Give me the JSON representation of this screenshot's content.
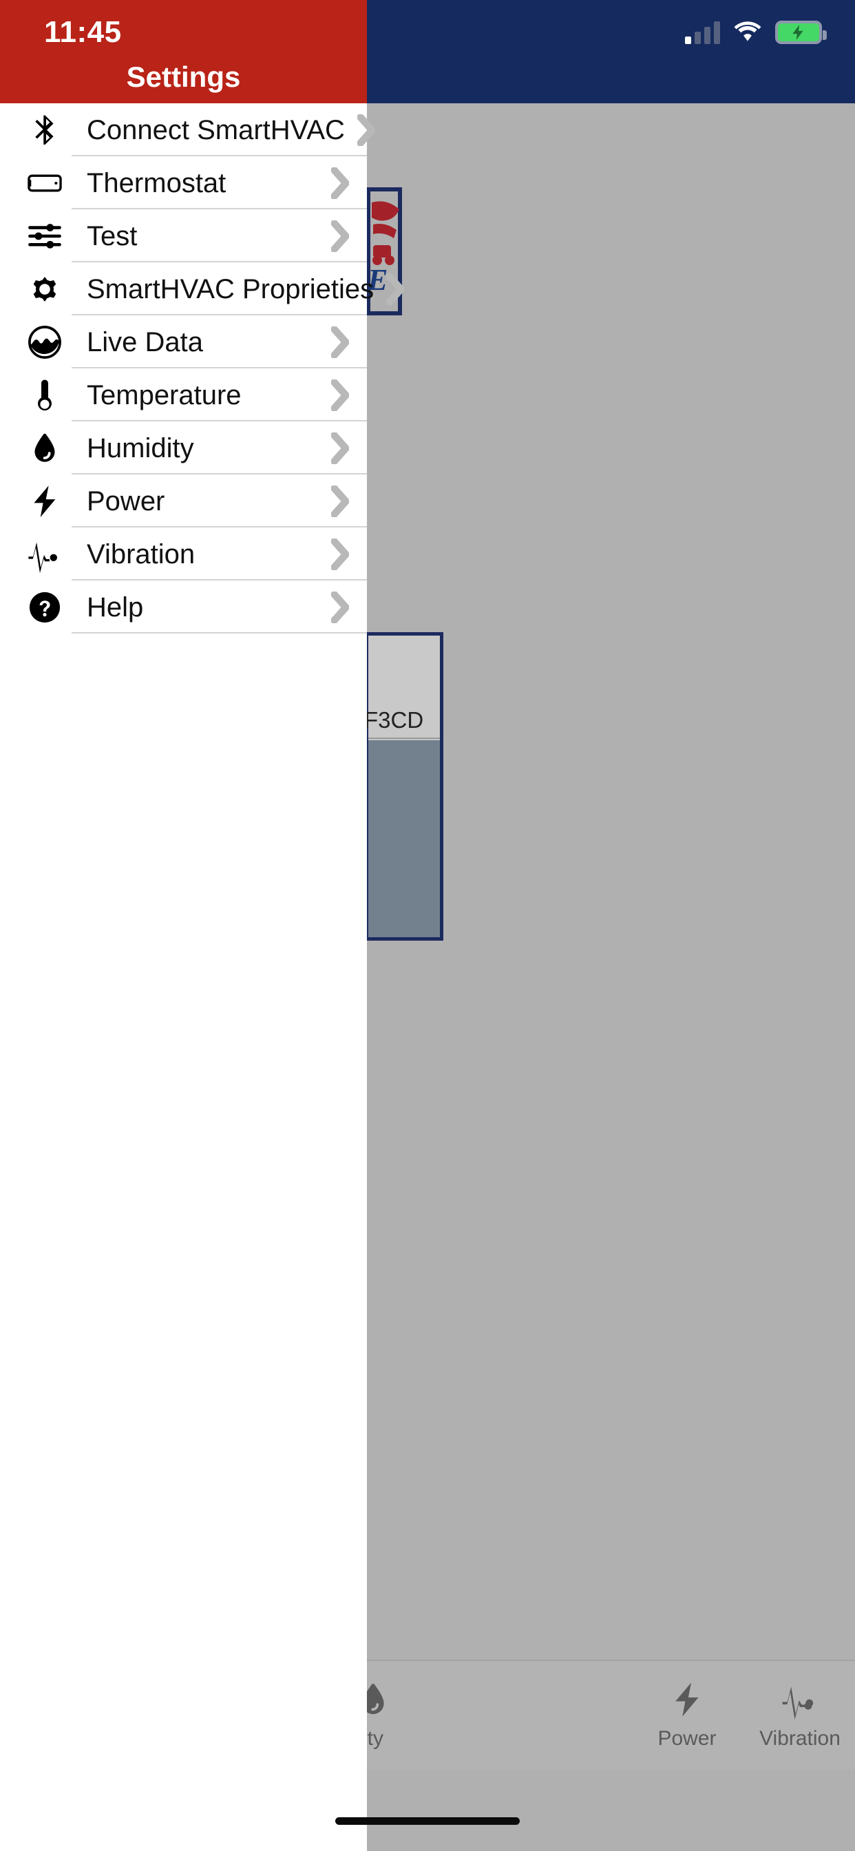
{
  "status_bar": {
    "time": "11:45",
    "signal_icon": "cellular-signal-icon",
    "wifi_icon": "wifi-icon",
    "battery_icon": "battery-charging-icon"
  },
  "drawer": {
    "title": "Settings",
    "accent_color": "#b92318",
    "items": [
      {
        "label": "Connect SmartHVAC",
        "icon": "bluetooth-icon",
        "chevron": "chevron-right-icon"
      },
      {
        "label": "Thermostat",
        "icon": "thermostat-device-icon",
        "chevron": "chevron-right-icon"
      },
      {
        "label": "Test",
        "icon": "sliders-icon",
        "chevron": "chevron-right-icon"
      },
      {
        "label": "SmartHVAC Proprieties",
        "icon": "gear-icon",
        "chevron": "chevron-right-icon"
      },
      {
        "label": "Live Data",
        "icon": "live-data-icon",
        "chevron": "chevron-right-icon"
      },
      {
        "label": "Temperature",
        "icon": "thermometer-icon",
        "chevron": "chevron-right-icon"
      },
      {
        "label": "Humidity",
        "icon": "water-drop-icon",
        "chevron": "chevron-right-icon"
      },
      {
        "label": "Power",
        "icon": "lightning-bolt-icon",
        "chevron": "chevron-right-icon"
      },
      {
        "label": "Vibration",
        "icon": "waveform-pulse-icon",
        "chevron": "chevron-right-icon"
      },
      {
        "label": "Help",
        "icon": "question-mark-circle-icon",
        "chevron": "chevron-right-icon"
      }
    ]
  },
  "background_app": {
    "logo_text": "E",
    "device_id": "F3CD",
    "tabs": [
      {
        "label": "ity",
        "icon": "water-drop-icon"
      },
      {
        "label": "Power",
        "icon": "lightning-bolt-icon"
      },
      {
        "label": "Vibration",
        "icon": "waveform-pulse-icon"
      }
    ]
  },
  "colors": {
    "brand_red": "#b92318",
    "brand_navy": "#152a5e",
    "scrim_gray": "#b0b0b0",
    "separator": "#d4d4d4",
    "chevron": "#b8b8b8"
  }
}
